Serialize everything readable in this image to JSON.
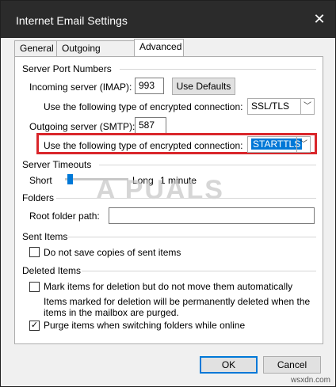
{
  "window": {
    "title": "Internet Email Settings",
    "close_glyph": "✕"
  },
  "tabs": [
    {
      "label": "General"
    },
    {
      "label": "Outgoing Server"
    },
    {
      "label": "Advanced"
    }
  ],
  "server_ports": {
    "group_label": "Server Port Numbers",
    "incoming_label": "Incoming server (IMAP):",
    "incoming_value": "993",
    "use_defaults_label": "Use Defaults",
    "incoming_enc_label": "Use the following type of encrypted connection:",
    "incoming_enc_value": "SSL/TLS",
    "outgoing_label": "Outgoing server (SMTP):",
    "outgoing_value": "587",
    "outgoing_enc_label": "Use the following type of encrypted connection:",
    "outgoing_enc_value": "STARTTLS"
  },
  "timeouts": {
    "group_label": "Server Timeouts",
    "short_label": "Short",
    "long_label": "Long",
    "value_label": "1 minute"
  },
  "folders": {
    "group_label": "Folders",
    "root_label": "Root folder path:",
    "root_value": ""
  },
  "sent_items": {
    "group_label": "Sent Items",
    "no_copies_label": "Do not save copies of sent items"
  },
  "deleted_items": {
    "group_label": "Deleted Items",
    "mark_label": "Mark items for deletion but do not move them automatically",
    "note_line1": "Items marked for deletion will be permanently deleted when the",
    "note_line2": "items in the mailbox are purged.",
    "purge_label": "Purge items when switching folders while online"
  },
  "footer": {
    "ok_label": "OK",
    "cancel_label": "Cancel"
  },
  "watermark": {
    "text": "A  PUALS",
    "site": "wsxdn.com"
  },
  "colors": {
    "accent": "#0078d7",
    "highlight_red": "#d9262b",
    "titlebar": "#2b2b2b"
  },
  "icons": {
    "close": "close-icon",
    "dropdown": "chevron-down-icon",
    "check": "checkmark-icon"
  }
}
